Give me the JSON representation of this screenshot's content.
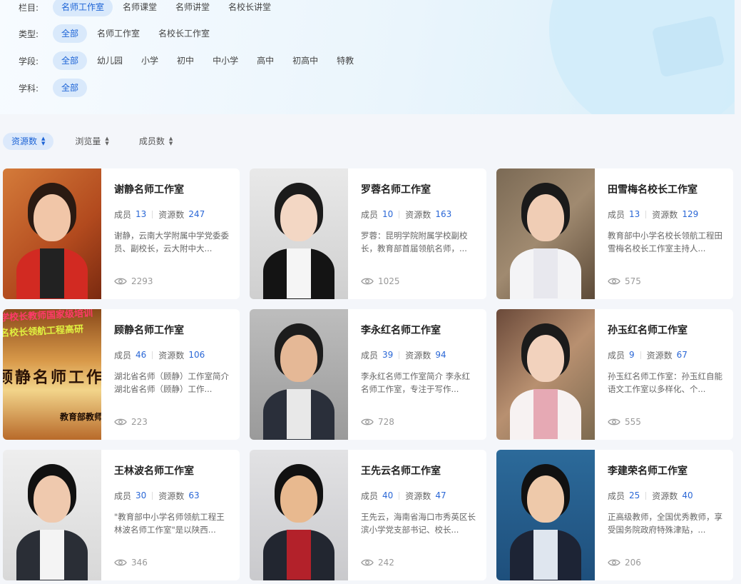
{
  "filters": [
    {
      "label": "栏目:",
      "options": [
        "名师工作室",
        "名师课堂",
        "名师讲堂",
        "名校长讲堂"
      ],
      "active": 0
    },
    {
      "label": "类型:",
      "options": [
        "全部",
        "名师工作室",
        "名校长工作室"
      ],
      "active": 0
    },
    {
      "label": "学段:",
      "options": [
        "全部",
        "幼儿园",
        "小学",
        "初中",
        "中小学",
        "高中",
        "初高中",
        "特教"
      ],
      "active": 0
    },
    {
      "label": "学科:",
      "options": [
        "全部"
      ],
      "active": 0
    }
  ],
  "sort": [
    {
      "label": "资源数",
      "active": true
    },
    {
      "label": "浏览量",
      "active": false
    },
    {
      "label": "成员数",
      "active": false
    }
  ],
  "labels": {
    "members": "成员",
    "resources": "资源数"
  },
  "cards": [
    {
      "title": "谢静名师工作室",
      "members": "13",
      "resources": "247",
      "desc": "谢静，云南大学附属中学党委委员、副校长，云大附中大...",
      "views": "2293"
    },
    {
      "title": "罗蓉名师工作室",
      "members": "10",
      "resources": "163",
      "desc": "罗蓉：昆明学院附属学校副校长，教育部首届领航名师，...",
      "views": "1025"
    },
    {
      "title": "田雪梅名校长工作室",
      "members": "13",
      "resources": "129",
      "desc": "教育部中小学名校长领航工程田雪梅名校长工作室主持人...",
      "views": "575"
    },
    {
      "title": "顾静名师工作室",
      "members": "46",
      "resources": "106",
      "desc": "湖北省名师（顾静）工作室简介 湖北省名师（顾静）工作...",
      "views": "223"
    },
    {
      "title": "李永红名师工作室",
      "members": "39",
      "resources": "94",
      "desc": "李永红名师工作室简介 李永红名师工作室，专注于写作...",
      "views": "728"
    },
    {
      "title": "孙玉红名师工作室",
      "members": "9",
      "resources": "67",
      "desc": "孙玉红名师工作室：孙玉红自能语文工作室以多样化、个...",
      "views": "555"
    },
    {
      "title": "王林波名师工作室",
      "members": "30",
      "resources": "63",
      "desc": "\"教育部中小学名师领航工程王林波名师工作室\"是以陕西...",
      "views": "346"
    },
    {
      "title": "王先云名师工作室",
      "members": "40",
      "resources": "47",
      "desc": "王先云，海南省海口市秀英区长滨小学党支部书记、校长...",
      "views": "242"
    },
    {
      "title": "李建荣名师工作室",
      "members": "25",
      "resources": "40",
      "desc": "正高级教师，全国优秀教师，享受国务院政府特殊津贴，...",
      "views": "206"
    }
  ],
  "banner_texts": [
    "学校长教师国家级培训",
    "名校长领航工程高研",
    "顾静名师工作室",
    "教育部教师"
  ]
}
